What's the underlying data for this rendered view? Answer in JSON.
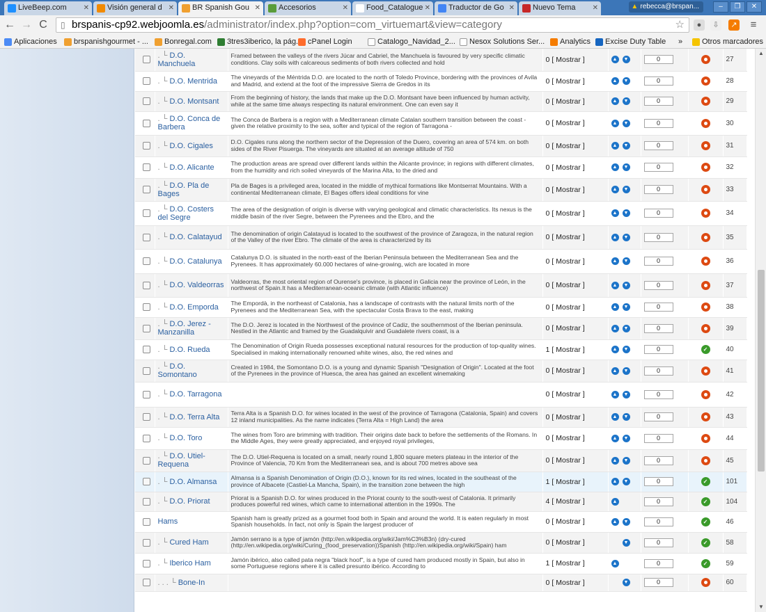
{
  "browser": {
    "tabs": [
      {
        "label": "LiveBeep.com",
        "color": "#1e90ff",
        "active": false
      },
      {
        "label": "Visión general d",
        "color": "#f18a00",
        "active": false
      },
      {
        "label": "BR Spanish Gou",
        "color": "#f0a030",
        "active": true
      },
      {
        "label": "Accesorios",
        "color": "#5a9c3a",
        "active": false
      },
      {
        "label": "Food_Catalogue",
        "color": "#ffffff",
        "active": false
      },
      {
        "label": "Traductor de Go",
        "color": "#4285f4",
        "active": false
      },
      {
        "label": "Nuevo Tema",
        "color": "#c62828",
        "active": false
      }
    ],
    "profile": "rebecca@brspan...",
    "window_buttons": [
      "–",
      "❐",
      "✕"
    ],
    "url_host": "brspanis-cp92.webjoomla.es",
    "url_path": "/administrator/index.php?option=com_virtuemart&view=category",
    "bookmarks": [
      {
        "label": "Aplicaciones",
        "color": "#4c8bf5"
      },
      {
        "label": "brspanishgourmet - ...",
        "color": "#f0a030"
      },
      {
        "label": "Bonregal.com",
        "color": "#f0a030"
      },
      {
        "label": "3tres3iberico, la pág...",
        "color": "#2e7d32"
      },
      {
        "label": "cPanel Login",
        "color": "#ff6c2c"
      },
      {
        "label": "Catalogo_Navidad_2...",
        "color": "#ffffff"
      },
      {
        "label": "Nesox Solutions Ser...",
        "color": "#ffffff"
      },
      {
        "label": "Analytics",
        "color": "#f57c00"
      },
      {
        "label": "Excise Duty Table",
        "color": "#1565c0"
      },
      {
        "label": "»",
        "color": ""
      },
      {
        "label": "Otros marcadores",
        "color": "#f5c400"
      }
    ]
  },
  "table": {
    "mostrar_label": "[ Mostrar ]",
    "rows": [
      {
        "name": "D.O. Manchuela",
        "prefix": ". └ ",
        "desc": "Framed between the valleys of the rivers Júcar and Cabriel, the Manchuela is favoured by very specific climatic conditions. Clay soils with calcareous sediments of both rivers collected and hold",
        "count": "0",
        "up": true,
        "down": true,
        "order": "0",
        "published": false,
        "id": "27"
      },
      {
        "name": "D.O. Mentrida",
        "prefix": ". └ ",
        "desc": "The vineyards of the Méntrida D.O. are located to the north of Toledo Province, bordering with the provinces of Avila and Madrid, and extend at the foot of the impressive Sierra de Gredos in its",
        "count": "0",
        "up": true,
        "down": true,
        "order": "0",
        "published": false,
        "id": "28"
      },
      {
        "name": "D.O. Montsant",
        "prefix": ". └ ",
        "desc": "From the beginning of history, the lands that make up the D.O. Montsant have been influenced by human activity, while at the same time always respecting its natural environment. One can even say it",
        "count": "0",
        "up": true,
        "down": true,
        "order": "0",
        "published": false,
        "id": "29"
      },
      {
        "name": "D.O. Conca de Barbera",
        "prefix": ". └ ",
        "desc": "The Conca de Barbera is a region with a Mediterranean climate Catalan southern transition between the coast - given the relative proximity to the sea, softer and typical of the region of Tarragona -",
        "count": "0",
        "up": true,
        "down": true,
        "order": "0",
        "published": false,
        "id": "30"
      },
      {
        "name": "D.O. Cigales",
        "prefix": ". └ ",
        "desc": "D.O. Cigales runs along the northern sector of the Depression of the Duero, covering an area of 574 km. on both sides of the River Pisuerga. The vineyards are situated at an average altitude of 750",
        "count": "0",
        "up": true,
        "down": true,
        "order": "0",
        "published": false,
        "id": "31"
      },
      {
        "name": "D.O. Alicante",
        "prefix": ". └ ",
        "desc": "The production areas are spread over different lands within the Alicante province; in regions with different climates, from the humidity and rich soiled vineyards of the Marina Alta, to the dried and",
        "count": "0",
        "up": true,
        "down": true,
        "order": "0",
        "published": false,
        "id": "32"
      },
      {
        "name": "D.O. Pla de Bages",
        "prefix": ". └ ",
        "desc": "Pla de Bages is a privileged area, located in the middle of mythical formations like Montserrat Mountains. With a continental Mediterranean climate, El Bages offers ideal conditions for vine",
        "count": "0",
        "up": true,
        "down": true,
        "order": "0",
        "published": false,
        "id": "33"
      },
      {
        "name": "D.O. Costers del Segre",
        "prefix": ". └ ",
        "desc": "The area of the designation of origin is diverse with varying geological and climatic characteristics. Its nexus is the middle basin of the river Segre, between the Pyrenees and the Ebro, and the",
        "count": "0",
        "up": true,
        "down": true,
        "order": "0",
        "published": false,
        "id": "34"
      },
      {
        "name": "D.O. Calatayud",
        "prefix": ". └ ",
        "desc": "The denomination of origin Calatayud is located to the southwest of the province of Zaragoza, in the natural region of the Valley of the river Ebro. The climate of the area is characterized by its",
        "count": "0",
        "up": true,
        "down": true,
        "order": "0",
        "published": false,
        "id": "35"
      },
      {
        "name": "D.O. Catalunya",
        "prefix": ". └ ",
        "desc": "Catalunya D.O. is situated in the north-east of the Iberian Peninsula between the Mediterranean Sea and the Pyrenees. It has approximately 60.000 hectares of wine-growing, wich are located in more",
        "count": "0",
        "up": true,
        "down": true,
        "order": "0",
        "published": false,
        "id": "36"
      },
      {
        "name": "D.O. Valdeorras",
        "prefix": ". └ ",
        "desc": "Valdeorras, the most oriental region of Ourense's province, is placed in Galicia near the province of León, in the northwest of Spain.It has a Mediterranean-oceanic climate (with Atlantic influence)",
        "count": "0",
        "up": true,
        "down": true,
        "order": "0",
        "published": false,
        "id": "37"
      },
      {
        "name": "D.O. Emporda",
        "prefix": ". └ ",
        "desc": "The Empordà, in the northeast of Catalonia, has a landscape of contrasts with the natural limits north of the Pyrenees and the Mediterranean Sea, with the spectacular Costa Brava to the east, making",
        "count": "0",
        "up": true,
        "down": true,
        "order": "0",
        "published": false,
        "id": "38"
      },
      {
        "name": "D.O. Jerez - Manzanilla",
        "prefix": ". └ ",
        "desc": "The D.O. Jerez is located in the Northwest of the province of Cadiz, the southernmost of the Iberian peninsula. Nestled in the Atlantic and framed by the Guadalquivir and Guadalete rivers coast, is a",
        "count": "0",
        "up": true,
        "down": true,
        "order": "0",
        "published": false,
        "id": "39"
      },
      {
        "name": "D.O. Rueda",
        "prefix": ". └ ",
        "desc": "The Denomination of Origin Rueda possesses exceptional natural resources for the production of top-quality wines. Specialised in making internationally renowned white wines, also, the red wines and",
        "count": "1",
        "up": true,
        "down": true,
        "order": "0",
        "published": true,
        "id": "40"
      },
      {
        "name": "D.O. Somontano",
        "prefix": ". └ ",
        "desc": "Created in 1984, the Somontano D.O. is a young and dynamic Spanish \"Designation of Origin\". Located at the foot of the Pyrenees in the province of Huesca, the area has gained an excellent winemaking",
        "count": "0",
        "up": true,
        "down": true,
        "order": "0",
        "published": false,
        "id": "41"
      },
      {
        "name": "D.O. Tarragona",
        "prefix": ". └ ",
        "desc": "",
        "count": "0",
        "up": true,
        "down": true,
        "order": "0",
        "published": false,
        "id": "42"
      },
      {
        "name": "D.O. Terra Alta",
        "prefix": ". └ ",
        "desc": "Terra Alta is a Spanish D.O. for wines located in the west of the province of Tarragona (Catalonia, Spain) and covers 12 inland municipalities. As the name indicates (Terra Alta = High Land) the area",
        "count": "0",
        "up": true,
        "down": true,
        "order": "0",
        "published": false,
        "id": "43"
      },
      {
        "name": "D.O. Toro",
        "prefix": ". └ ",
        "desc": "The wines from Toro are brimming with tradition. Their origins date back to before the settlements of the Romans. In the Middle Ages, they were greatly appreciated, and enjoyed royal privileges,",
        "count": "0",
        "up": true,
        "down": true,
        "order": "0",
        "published": false,
        "id": "44"
      },
      {
        "name": "D.O. Utiel-Requena",
        "prefix": ". └ ",
        "desc": "The D.O. Utiel-Requena is located on a small, nearly round 1,800 square meters plateau in the interior of the Province of Valencia, 70 Km from the Mediterranean sea, and is about 700 metres above sea",
        "count": "0",
        "up": true,
        "down": true,
        "order": "0",
        "published": false,
        "id": "45"
      },
      {
        "name": "D.O. Almansa",
        "prefix": ". └ ",
        "desc": "Almansa is a Spanish Denomination of Origin (D.O.), known for its red wines, located in the southeast of the province of Albacete (Castiel-La Mancha, Spain), in the transition zone between the high",
        "count": "1",
        "up": true,
        "down": true,
        "order": "0",
        "published": true,
        "id": "101",
        "highlight": true
      },
      {
        "name": "D.O. Priorat",
        "prefix": ". └ ",
        "desc": "Priorat is a Spanish D.O. for wines produced in the Priorat county to the south-west of Catalonia. It primarily produces powerful red wines, which came to international attention in the 1990s. The",
        "count": "4",
        "up": true,
        "down": false,
        "order": "0",
        "published": true,
        "id": "104"
      },
      {
        "name": "Hams",
        "prefix": "",
        "desc": "Spanish ham is greatly prized as a gourmet food both in Spain and around the world. It is eaten regularly in most Spanish households. In fact, not only is Spain the largest producer of",
        "count": "0",
        "up": true,
        "down": true,
        "order": "0",
        "published": true,
        "id": "46"
      },
      {
        "name": "Cured Ham",
        "prefix": ". └ ",
        "desc": "Jamón serrano is a type of jamón (http://en.wikipedia.org/wiki/Jam%C3%B3n) (dry-cured (http://en.wikipedia.org/wiki/Curing_(food_preservation))Spanish (http://en.wikipedia.org/wiki/Spain) ham",
        "count": "0",
        "up": false,
        "down": true,
        "order": "0",
        "published": true,
        "id": "58"
      },
      {
        "name": "Iberico Ham",
        "prefix": ". └ ",
        "desc": "Jamón ibérico, also called pata negra \"black hoof\", is a type of cured ham produced mostly in Spain, but also in some Portuguese regions where it is called presunto ibérico. According to",
        "count": "1",
        "up": true,
        "down": false,
        "order": "0",
        "published": true,
        "id": "59"
      },
      {
        "name": "Bone-In",
        "prefix": ". . . └ ",
        "desc": "",
        "count": "0",
        "up": false,
        "down": true,
        "order": "0",
        "published": false,
        "id": "60"
      }
    ]
  }
}
